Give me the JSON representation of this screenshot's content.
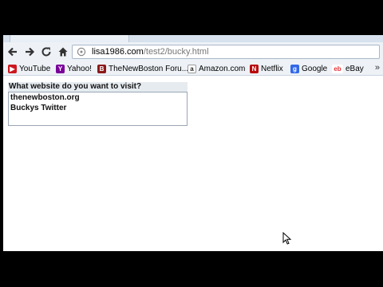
{
  "browser": {
    "url_host": "lisa1986.com",
    "url_path": "/test2/bucky.html",
    "bookmarks": [
      {
        "label": "YouTube",
        "icon": "youtube-icon",
        "color": "#cc181e"
      },
      {
        "label": "Yahoo!",
        "icon": "yahoo-icon",
        "color": "#7b0099"
      },
      {
        "label": "TheNewBoston Foru...",
        "icon": "thenewboston-icon",
        "color": "#8b1a1a"
      },
      {
        "label": "Amazon.com",
        "icon": "amazon-icon",
        "color": "#222222"
      },
      {
        "label": "Netflix",
        "icon": "netflix-icon",
        "color": "#b9090b"
      },
      {
        "label": "Google",
        "icon": "google-icon",
        "color": "#3369e8"
      },
      {
        "label": "eBay",
        "icon": "ebay-icon",
        "color": "#e53238"
      }
    ],
    "more_label": "»"
  },
  "page": {
    "question": "What website do you want to visit?",
    "options": [
      "thenewboston.org",
      "Buckys Twitter"
    ]
  }
}
